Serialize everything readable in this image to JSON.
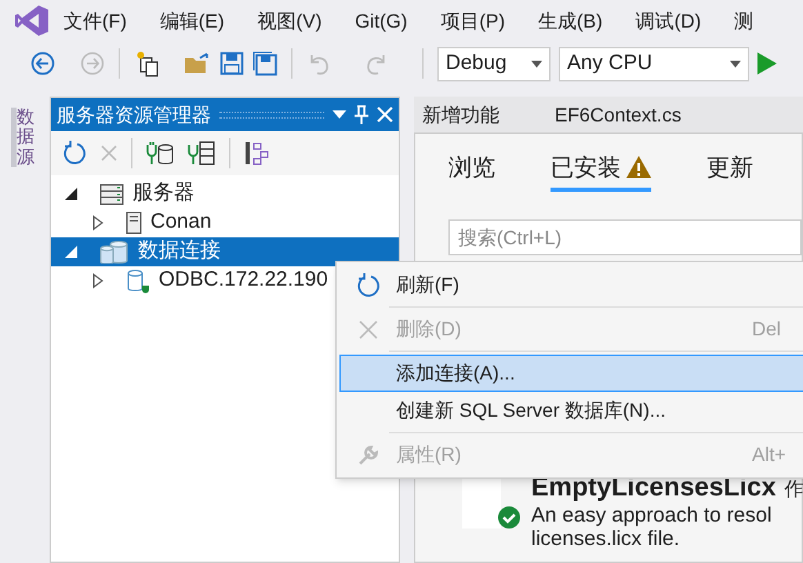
{
  "menu_bar": [
    {
      "label": "文件(F)"
    },
    {
      "label": "编辑(E)"
    },
    {
      "label": "视图(V)"
    },
    {
      "label": "Git(G)"
    },
    {
      "label": "项目(P)"
    },
    {
      "label": "生成(B)"
    },
    {
      "label": "调试(D)"
    },
    {
      "label": "测"
    }
  ],
  "toolbar": {
    "configuration": "Debug",
    "platform": "Any CPU"
  },
  "side_tab": "数据源",
  "server_explorer": {
    "title": "服务器资源管理器",
    "tree": [
      {
        "label": "服务器",
        "kind": "server",
        "expanded": true,
        "selected": false,
        "children": [
          {
            "label": "Conan",
            "kind": "computer",
            "expanded": false,
            "selected": false
          }
        ]
      },
      {
        "label": "数据连接",
        "kind": "connections",
        "expanded": true,
        "selected": true,
        "children": [
          {
            "label": "ODBC.172.22.190",
            "kind": "database",
            "expanded": false,
            "selected": false
          }
        ]
      }
    ]
  },
  "document_tabs": [
    {
      "label": "新增功能"
    },
    {
      "label": "EF6Context.cs"
    }
  ],
  "nuget": {
    "tabs": [
      {
        "label": "浏览",
        "selected": false,
        "warning": false
      },
      {
        "label": "已安装",
        "selected": true,
        "warning": true
      },
      {
        "label": "更新",
        "selected": false,
        "warning": false
      }
    ],
    "search": {
      "placeholder": "搜索(Ctrl+L)"
    },
    "package": {
      "name": "EmptyLicensesLicx",
      "author": "作",
      "description": [
        "An easy approach to resol",
        "licenses.licx file."
      ],
      "installed": true
    }
  },
  "context_menu": [
    {
      "kind": "item",
      "label": "刷新(F)",
      "disabled": false,
      "selected": false
    },
    {
      "kind": "separator"
    },
    {
      "kind": "item",
      "label": "删除(D)",
      "shortcut": "Del",
      "disabled": true,
      "selected": false
    },
    {
      "kind": "separator"
    },
    {
      "kind": "item",
      "label": "添加连接(A)...",
      "disabled": false,
      "selected": true
    },
    {
      "kind": "item",
      "label": "创建新 SQL Server 数据库(N)...",
      "disabled": false,
      "selected": false
    },
    {
      "kind": "separator"
    },
    {
      "kind": "item",
      "label": "属性(R)",
      "shortcut": "Alt+",
      "disabled": true,
      "selected": false
    }
  ]
}
